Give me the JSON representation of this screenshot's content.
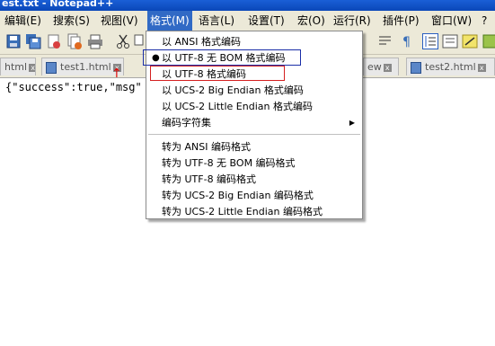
{
  "window": {
    "title": "est.txt - Notepad++"
  },
  "menubar": {
    "items": [
      {
        "label": "编辑(E)"
      },
      {
        "label": "搜索(S)"
      },
      {
        "label": "视图(V)"
      },
      {
        "label": "格式(M)"
      },
      {
        "label": "语言(L)"
      },
      {
        "label": "设置(T)"
      },
      {
        "label": "宏(O)"
      },
      {
        "label": "运行(R)"
      },
      {
        "label": "插件(P)"
      },
      {
        "label": "窗口(W)"
      },
      {
        "label": "?"
      }
    ]
  },
  "tabs": [
    {
      "label": "html"
    },
    {
      "label": "test1.html"
    },
    {
      "label": "ew"
    },
    {
      "label": "test2.html"
    }
  ],
  "editor": {
    "line1": "{\"success\":true,\"msg\""
  },
  "format_menu": {
    "items": [
      {
        "label": "以 ANSI 格式编码"
      },
      {
        "label": "以 UTF-8 无 BOM 格式编码",
        "bullet": "●"
      },
      {
        "label": "以 UTF-8 格式编码"
      },
      {
        "label": "以 UCS-2 Big Endian 格式编码"
      },
      {
        "label": "以 UCS-2 Little Endian 格式编码"
      },
      {
        "label": "编码字符集",
        "arrow": "▶"
      },
      {
        "label": "转为 ANSI 编码格式"
      },
      {
        "label": "转为 UTF-8 无 BOM 编码格式"
      },
      {
        "label": "转为 UTF-8 编码格式"
      },
      {
        "label": "转为 UCS-2 Big Endian 编码格式"
      },
      {
        "label": "转为 UCS-2 Little Endian 编码格式"
      }
    ]
  },
  "colors": {
    "menu_highlight": "#316ac5",
    "annotation_blue": "#1a2ea8",
    "annotation_red": "#d42020"
  }
}
